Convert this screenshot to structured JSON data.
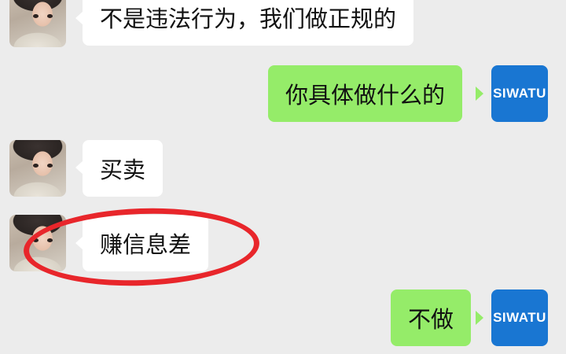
{
  "messages": [
    {
      "side": "left",
      "text": "不是违法行为，我们做正规的"
    },
    {
      "side": "right",
      "text": "你具体做什么的"
    },
    {
      "side": "left",
      "text": "买卖"
    },
    {
      "side": "left",
      "text": "赚信息差"
    },
    {
      "side": "right",
      "text": "不做"
    }
  ],
  "avatars": {
    "contact": "child-photo-avatar",
    "self_logo_text": "SIWATU"
  },
  "colors": {
    "chat_background": "#ececec",
    "incoming_bubble": "#ffffff",
    "outgoing_bubble": "#95ec69",
    "self_avatar": "#1976d2",
    "highlight": "#e8262b"
  }
}
